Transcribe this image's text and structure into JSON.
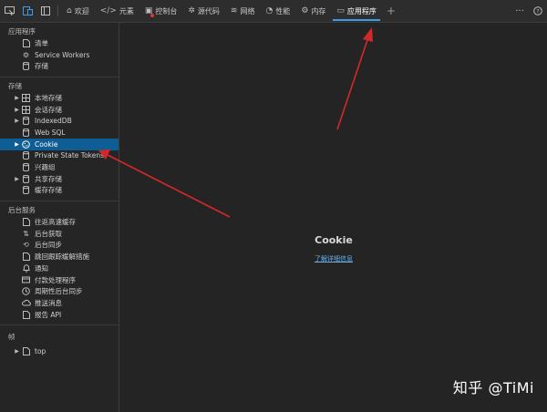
{
  "toolbar": {
    "left_icons": [
      "inspect-icon",
      "device-icon",
      "sidebar-toggle-icon"
    ],
    "tabs": [
      {
        "label": "欢迎",
        "icon": "home-icon",
        "glyph": "⌂"
      },
      {
        "label": "元素",
        "icon": "code-icon",
        "glyph": "</>"
      },
      {
        "label": "控制台",
        "icon": "console-icon",
        "glyph": "▣"
      },
      {
        "label": "源代码",
        "icon": "bug-icon",
        "glyph": "✲"
      },
      {
        "label": "网络",
        "icon": "wifi-icon",
        "glyph": "≋"
      },
      {
        "label": "性能",
        "icon": "gauge-icon",
        "glyph": "◔"
      },
      {
        "label": "内存",
        "icon": "gear-icon",
        "glyph": "⚙"
      },
      {
        "label": "应用程序",
        "icon": "app-icon",
        "glyph": "▭"
      }
    ],
    "active_tab": "应用程序",
    "more_label": "···",
    "help_label": "?",
    "accent": "#3c9bea",
    "badge_color": "#e0362a"
  },
  "sidebar": {
    "app": {
      "title": "应用程序",
      "items": [
        "清单",
        "Service Workers",
        "存储"
      ]
    },
    "storage": {
      "title": "存储",
      "items": [
        "本地存储",
        "会话存储",
        "IndexedDB",
        "Web SQL",
        "Cookie",
        "Private State Tokens",
        "兴趣组",
        "共享存储",
        "缓存存储"
      ],
      "selected": "Cookie"
    },
    "background": {
      "title": "后台服务",
      "items": [
        "往返高速缓存",
        "后台获取",
        "后台同步",
        "跳回跟踪缓解措施",
        "通知",
        "付款处理程序",
        "周期性后台同步",
        "推送消息",
        "报告 API"
      ]
    },
    "frames": {
      "title": "帧",
      "items": [
        "top"
      ]
    },
    "selected_color": "#0e5d94"
  },
  "main": {
    "title": "Cookie",
    "link": "了解详细信息"
  },
  "watermark": "知乎 @TiMi"
}
